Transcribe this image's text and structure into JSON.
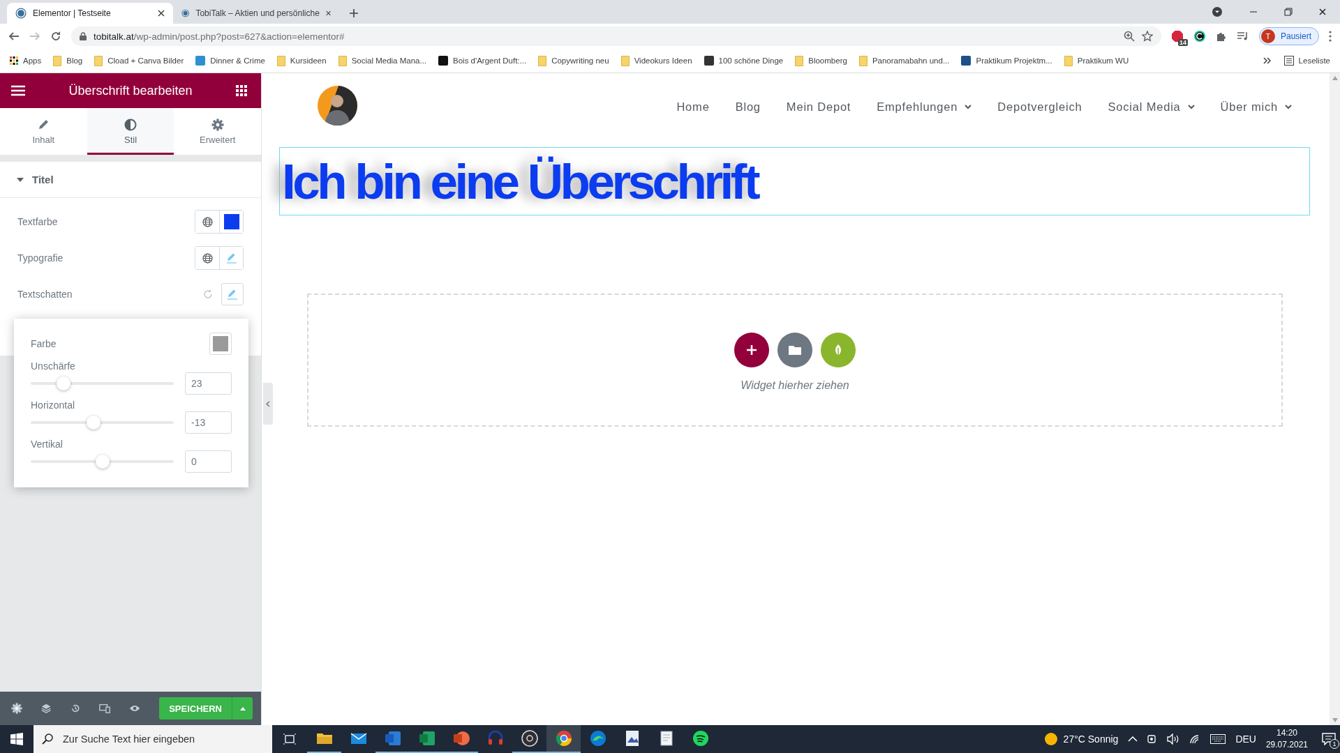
{
  "browser": {
    "tabs": [
      {
        "title": "Elementor | Testseite",
        "selected": true
      },
      {
        "title": "TobiTalk – Aktien und persönliche",
        "selected": false
      }
    ],
    "url": "tobitalk.at/wp-admin/post.php?post=627&action=elementor#",
    "extension_badge": "14",
    "profile": {
      "initial": "T",
      "label": "Pausiert"
    },
    "bookmarks": [
      {
        "label": "Apps",
        "kind": "apps"
      },
      {
        "label": "Blog",
        "kind": "folder"
      },
      {
        "label": "Cload + Canva Bilder",
        "kind": "folder"
      },
      {
        "label": "Dinner & Crime",
        "kind": "site",
        "color": "#2f8fd0"
      },
      {
        "label": "Kursideen",
        "kind": "folder"
      },
      {
        "label": "Social Media Mana...",
        "kind": "folder"
      },
      {
        "label": "Bois d'Argent Duft:...",
        "kind": "site",
        "color": "#111111"
      },
      {
        "label": "Copywriting neu",
        "kind": "folder"
      },
      {
        "label": "Videokurs Ideen",
        "kind": "folder"
      },
      {
        "label": "100 schöne Dinge",
        "kind": "site",
        "color": "#333333"
      },
      {
        "label": "Bloomberg",
        "kind": "folder"
      },
      {
        "label": "Panoramabahn und...",
        "kind": "folder"
      },
      {
        "label": "Praktikum Projektm...",
        "kind": "site",
        "color": "#1d4f8a"
      },
      {
        "label": "Praktikum WU",
        "kind": "folder"
      }
    ],
    "reading_list": "Leseliste"
  },
  "editor": {
    "title": "Überschrift bearbeiten",
    "tabs": [
      {
        "label": "Inhalt",
        "kind": "pencil",
        "selected": false
      },
      {
        "label": "Stil",
        "kind": "contrast",
        "selected": true
      },
      {
        "label": "Erweitert",
        "kind": "gear",
        "selected": false
      }
    ],
    "section": {
      "title": "Titel",
      "expanded": true
    },
    "controls": [
      {
        "label": "Textfarbe",
        "kind": "color",
        "color": "#0c3cf0"
      },
      {
        "label": "Typografie",
        "kind": "typography"
      },
      {
        "label": "Textschatten",
        "kind": "shadow"
      }
    ],
    "shadow": {
      "color_label": "Farbe",
      "color": "#9a9a9a",
      "sliders": [
        {
          "label": "Unschärfe",
          "value": "23",
          "level": 0.23
        },
        {
          "label": "Horizontal",
          "value": "-13",
          "level": 0.44
        },
        {
          "label": "Vertikal",
          "value": "0",
          "level": 0.5
        }
      ]
    },
    "save": "SPEICHERN"
  },
  "preview": {
    "nav": [
      {
        "label": "Home",
        "dropdown": false
      },
      {
        "label": "Blog",
        "dropdown": false
      },
      {
        "label": "Mein Depot",
        "dropdown": false
      },
      {
        "label": "Empfehlungen",
        "dropdown": true
      },
      {
        "label": "Depotvergleich",
        "dropdown": false
      },
      {
        "label": "Social Media",
        "dropdown": true
      },
      {
        "label": "Über mich",
        "dropdown": true
      }
    ],
    "heading": "Ich bin eine Überschrift",
    "drop_hint": "Widget hierher ziehen"
  },
  "taskbar": {
    "search_placeholder": "Zur Suche Text hier eingeben",
    "apps": [
      {
        "kind": "folder",
        "running": true,
        "active": false
      },
      {
        "kind": "mail",
        "running": false,
        "active": false
      },
      {
        "kind": "document",
        "running": true,
        "active": false
      },
      {
        "kind": "spreadsheet",
        "running": true,
        "active": false
      },
      {
        "kind": "presentation",
        "running": true,
        "active": false
      },
      {
        "kind": "headphones",
        "running": false,
        "active": false
      },
      {
        "kind": "aperture",
        "running": true,
        "active": false
      },
      {
        "kind": "browser",
        "running": true,
        "active": true
      },
      {
        "kind": "wave",
        "running": false,
        "active": false
      },
      {
        "kind": "image",
        "running": false,
        "active": false
      },
      {
        "kind": "notepad",
        "running": false,
        "active": false
      },
      {
        "kind": "music",
        "running": false,
        "active": false
      }
    ],
    "weather": "27°C Sonnig",
    "language": "DEU",
    "time": "14:20",
    "date": "29.07.2021",
    "notifications": "1"
  }
}
